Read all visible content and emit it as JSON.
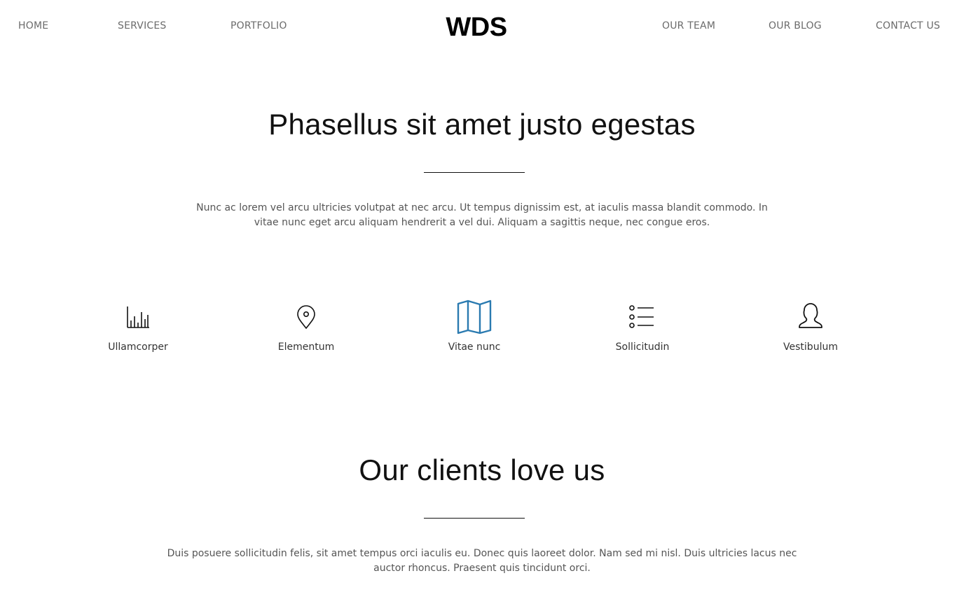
{
  "nav": {
    "left": [
      "HOME",
      "SERVICES",
      "PORTFOLIO"
    ],
    "right": [
      "OUR TEAM",
      "OUR BLOG",
      "CONTACT US"
    ],
    "logo": "WDS"
  },
  "intro": {
    "title": "Phasellus sit amet justo egestas",
    "text_line1": "Nunc ac lorem vel arcu ultricies volutpat at nec arcu. Ut tempus dignissim est, at iaculis massa blandit commodo. In",
    "text_line2": "vitae nunc eget arcu aliquam hendrerit a vel dui. Aliquam a sagittis neque, nec congue eros."
  },
  "features": [
    {
      "label": "Ullamcorper",
      "icon": "bar-chart-icon"
    },
    {
      "label": "Elementum",
      "icon": "location-pin-icon"
    },
    {
      "label": "Vitae nunc",
      "icon": "map-icon"
    },
    {
      "label": "Sollicitudin",
      "icon": "list-icon"
    },
    {
      "label": "Vestibulum",
      "icon": "user-icon"
    }
  ],
  "clients": {
    "title": "Our clients love us",
    "text_line1": "Duis posuere sollicitudin felis, sit amet tempus orci iaculis eu. Donec quis laoreet dolor. Nam sed mi nisl. Duis ultricies lacus nec",
    "text_line2": "auctor rhoncus. Praesent quis tincidunt orci."
  },
  "colors": {
    "accent": "#2a7ab0",
    "nav_text": "#6b6b6b",
    "body_text": "#555555"
  }
}
